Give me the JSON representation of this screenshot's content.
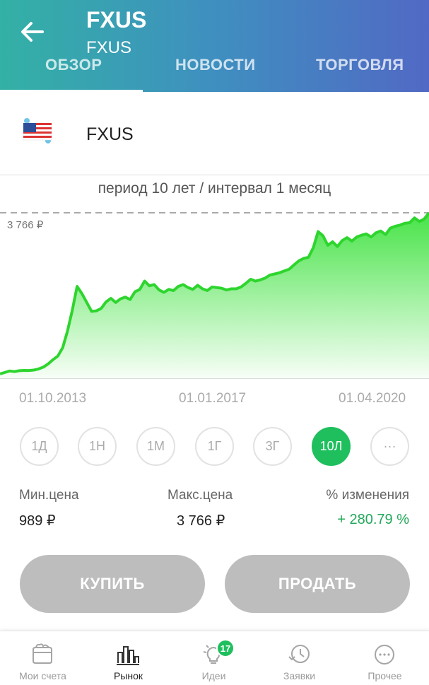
{
  "header": {
    "title": "FXUS",
    "subtitle": "FXUS",
    "tabs": [
      {
        "label": "ОБЗОР",
        "active": true
      },
      {
        "label": "НОВОСТИ",
        "active": false
      },
      {
        "label": "ТОРГОВЛЯ",
        "active": false
      }
    ]
  },
  "instrument": {
    "name": "FXUS",
    "flag_icon": "us-flag-icon"
  },
  "period_caption": "период 10 лет / интервал 1 месяц",
  "chart_data": {
    "type": "area",
    "max_label": "3 766 ₽",
    "ylim": [
      989,
      3766
    ],
    "x_tick_labels": [
      "01.10.2013",
      "01.01.2017",
      "01.04.2020"
    ],
    "line_color": "#2ed52e",
    "fill_color": "#3ee23e",
    "values": [
      1060,
      1085,
      1110,
      1100,
      1115,
      1120,
      1118,
      1125,
      1145,
      1175,
      1230,
      1300,
      1360,
      1500,
      1780,
      2130,
      2530,
      2410,
      2260,
      2110,
      2120,
      2160,
      2270,
      2330,
      2260,
      2320,
      2350,
      2310,
      2440,
      2480,
      2620,
      2540,
      2560,
      2470,
      2430,
      2480,
      2460,
      2530,
      2560,
      2510,
      2480,
      2550,
      2490,
      2460,
      2520,
      2510,
      2500,
      2470,
      2490,
      2490,
      2520,
      2580,
      2650,
      2620,
      2640,
      2670,
      2720,
      2740,
      2760,
      2790,
      2820,
      2890,
      2960,
      3000,
      3020,
      3180,
      3450,
      3380,
      3220,
      3280,
      3200,
      3300,
      3350,
      3290,
      3360,
      3390,
      3410,
      3360,
      3430,
      3460,
      3400,
      3510,
      3540,
      3560,
      3590,
      3600,
      3680,
      3620,
      3660,
      3766
    ]
  },
  "period_buttons": [
    {
      "label": "1Д",
      "active": false
    },
    {
      "label": "1Н",
      "active": false
    },
    {
      "label": "1М",
      "active": false
    },
    {
      "label": "1Г",
      "active": false
    },
    {
      "label": "3Г",
      "active": false
    },
    {
      "label": "10Л",
      "active": true
    },
    {
      "label": "···",
      "active": false
    }
  ],
  "stats": {
    "min_label": "Мин.цена",
    "min_value": "989 ₽",
    "max_label": "Макс.цена",
    "max_value": "3 766 ₽",
    "change_label": "% изменения",
    "change_value": "+ 280.79 %"
  },
  "actions": {
    "buy": "КУПИТЬ",
    "sell": "ПРОДАТЬ"
  },
  "nav": {
    "items": [
      {
        "label": "Мои счета",
        "icon": "wallet-icon",
        "active": false
      },
      {
        "label": "Рынок",
        "icon": "market-chart-icon",
        "active": true
      },
      {
        "label": "Идеи",
        "icon": "lightbulb-icon",
        "active": false,
        "badge": "17"
      },
      {
        "label": "Заявки",
        "icon": "clock-history-icon",
        "active": false
      },
      {
        "label": "Прочее",
        "icon": "more-icon",
        "active": false
      }
    ]
  },
  "colors": {
    "accent_green": "#1fbf5e",
    "button_gray": "#bdbdbd"
  }
}
